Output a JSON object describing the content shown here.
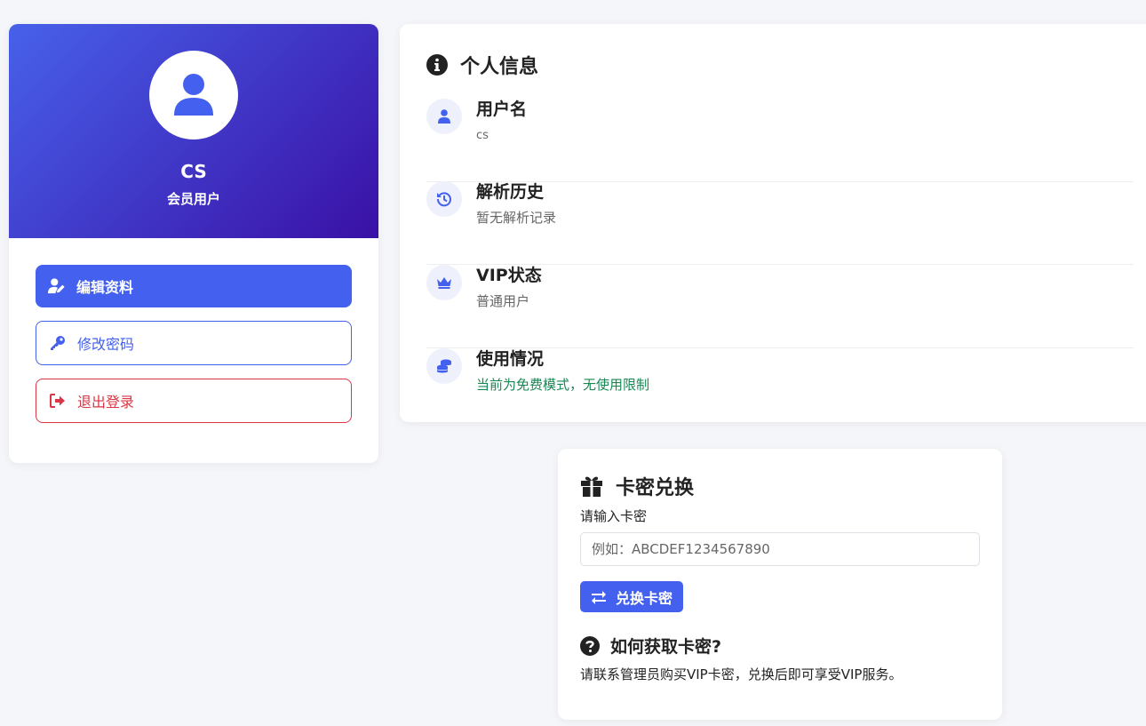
{
  "profile": {
    "username": "CS",
    "role": "会员用户",
    "actions": {
      "edit_label": "编辑资料",
      "password_label": "修改密码",
      "logout_label": "退出登录"
    }
  },
  "info": {
    "title": "个人信息",
    "items": [
      {
        "label": "用户名",
        "value": "cs"
      },
      {
        "label": "解析历史",
        "value": "暂无解析记录"
      },
      {
        "label": "VIP状态",
        "value": "普通用户"
      },
      {
        "label": "使用情况",
        "value": "当前为免费模式，无使用限制"
      }
    ]
  },
  "redeem": {
    "title": "卡密兑换",
    "input_label": "请输入卡密",
    "input_placeholder": "例如：ABCDEF1234567890",
    "button_label": "兑换卡密",
    "help_title": "如何获取卡密?",
    "help_text": "请联系管理员购买VIP卡密，兑换后即可享受VIP服务。"
  },
  "colors": {
    "primary": "#4361ee",
    "danger": "#dc3545",
    "success": "#198754",
    "header_gradient_start": "#4761ea",
    "header_gradient_end": "#3a10a6"
  }
}
